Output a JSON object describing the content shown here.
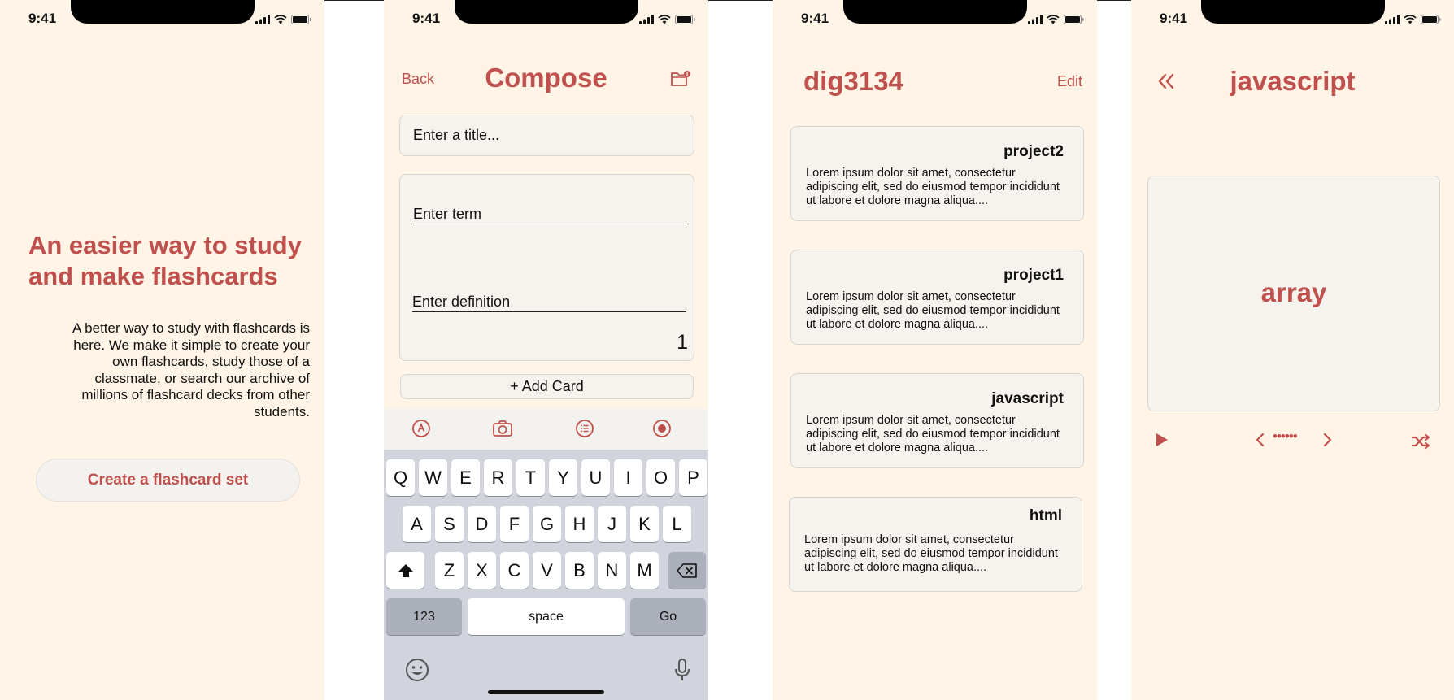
{
  "status": {
    "time": "9:41"
  },
  "colors": {
    "accent": "#c0504d",
    "background": "#fff4e6",
    "card": "#f6f3ee"
  },
  "welcome": {
    "title": "An easier way to study and make flashcards",
    "body": "A better way to study with flashcards is here. We make it simple to create your own flashcards, study those of a classmate, or search our archive of millions of flashcard decks from other students.",
    "cta": "Create a flashcard set"
  },
  "compose": {
    "back": "Back",
    "title": "Compose",
    "title_placeholder": "Enter a title...",
    "term_placeholder": "Enter term",
    "definition_placeholder": "Enter definition",
    "card_number": "1",
    "add_card": "+ Add Card",
    "toolbar_icons": [
      "markup-icon",
      "camera-icon",
      "list-icon",
      "record-icon"
    ]
  },
  "keyboard": {
    "row1": [
      "Q",
      "W",
      "E",
      "R",
      "T",
      "Y",
      "U",
      "I",
      "O",
      "P"
    ],
    "row2": [
      "A",
      "S",
      "D",
      "F",
      "G",
      "H",
      "J",
      "K",
      "L"
    ],
    "row3": [
      "Z",
      "X",
      "C",
      "V",
      "B",
      "N",
      "M"
    ],
    "numbers": "123",
    "space": "space",
    "go": "Go"
  },
  "deck_list": {
    "title": "dig3134",
    "edit": "Edit",
    "decks": [
      {
        "name": "project2",
        "description": "Lorem ipsum dolor sit amet, consectetur adipiscing elit, sed do eiusmod tempor incididunt ut labore et dolore magna aliqua...."
      },
      {
        "name": "project1",
        "description": "Lorem ipsum dolor sit amet, consectetur adipiscing elit, sed do eiusmod tempor incididunt ut labore et dolore magna aliqua...."
      },
      {
        "name": "javascript",
        "description": "Lorem ipsum dolor sit amet, consectetur adipiscing elit, sed do eiusmod tempor incididunt ut labore et dolore magna aliqua...."
      },
      {
        "name": "html",
        "description": "Lorem ipsum dolor sit amet, consectetur adipiscing elit, sed do eiusmod tempor incididunt ut labore et dolore magna aliqua...."
      }
    ]
  },
  "study": {
    "title": "javascript",
    "term": "array",
    "progress_dots": "••••••"
  }
}
